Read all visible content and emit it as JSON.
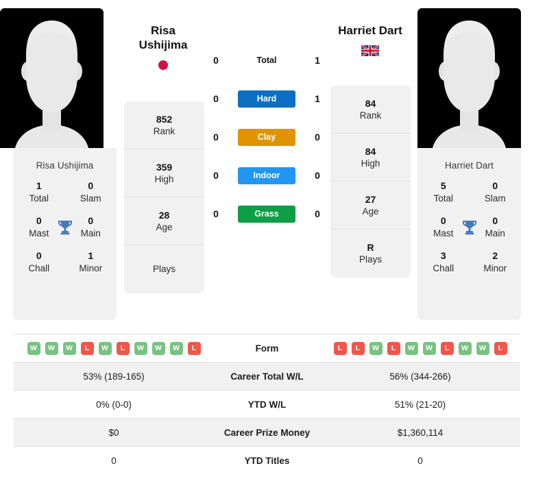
{
  "players": {
    "left": {
      "first_name": "Risa",
      "last_name": "Ushijima",
      "full_name": "Risa Ushijima",
      "flag_icon": "flag-japan-icon",
      "stats": [
        {
          "value": "852",
          "label": "Rank"
        },
        {
          "value": "359",
          "label": "High"
        },
        {
          "value": "28",
          "label": "Age"
        },
        {
          "value": "",
          "label": "Plays"
        }
      ],
      "titles": [
        {
          "value": "1",
          "label": "Total"
        },
        {
          "value": "0",
          "label": "Slam"
        },
        {
          "value": "0",
          "label": "Mast"
        },
        {
          "value": "0",
          "label": "Main"
        },
        {
          "value": "0",
          "label": "Chall"
        },
        {
          "value": "1",
          "label": "Minor"
        }
      ],
      "form": [
        "W",
        "W",
        "W",
        "L",
        "W",
        "L",
        "W",
        "W",
        "W",
        "L"
      ],
      "career_total_wl": "53% (189-165)",
      "ytd_wl": "0% (0-0)",
      "career_prize_money": "$0",
      "ytd_titles": "0"
    },
    "right": {
      "first_name": "Harriet",
      "last_name": "Dart",
      "full_name": "Harriet Dart",
      "flag_icon": "flag-united-kingdom-icon",
      "stats": [
        {
          "value": "84",
          "label": "Rank"
        },
        {
          "value": "84",
          "label": "High"
        },
        {
          "value": "27",
          "label": "Age"
        },
        {
          "value": "R",
          "label": "Plays"
        }
      ],
      "titles": [
        {
          "value": "5",
          "label": "Total"
        },
        {
          "value": "0",
          "label": "Slam"
        },
        {
          "value": "0",
          "label": "Mast"
        },
        {
          "value": "0",
          "label": "Main"
        },
        {
          "value": "3",
          "label": "Chall"
        },
        {
          "value": "2",
          "label": "Minor"
        }
      ],
      "form": [
        "L",
        "L",
        "W",
        "L",
        "W",
        "W",
        "L",
        "W",
        "W",
        "L"
      ],
      "career_total_wl": "56% (344-266)",
      "ytd_wl": "51% (21-20)",
      "career_prize_money": "$1,360,114",
      "ytd_titles": "0"
    }
  },
  "head_to_head": [
    {
      "label": "Total",
      "left": "0",
      "right": "1",
      "badge": false,
      "color": ""
    },
    {
      "label": "Hard",
      "left": "0",
      "right": "1",
      "badge": true,
      "color": "#0c6fc4"
    },
    {
      "label": "Clay",
      "left": "0",
      "right": "0",
      "badge": true,
      "color": "#e09400"
    },
    {
      "label": "Indoor",
      "left": "0",
      "right": "0",
      "badge": true,
      "color": "#2196f3"
    },
    {
      "label": "Grass",
      "left": "0",
      "right": "0",
      "badge": true,
      "color": "#0f9d45"
    }
  ],
  "comparison_rows": [
    {
      "label": "Form",
      "type": "form"
    },
    {
      "label": "Career Total W/L",
      "type": "text",
      "key": "career_total_wl"
    },
    {
      "label": "YTD W/L",
      "type": "text",
      "key": "ytd_wl"
    },
    {
      "label": "Career Prize Money",
      "type": "text",
      "key": "career_prize_money"
    },
    {
      "label": "YTD Titles",
      "type": "text",
      "key": "ytd_titles"
    }
  ],
  "colors": {
    "card_bg": "#f1f1f1",
    "win": "#78c283",
    "loss": "#f0564a",
    "trophy": "#4a7ab5",
    "japan_red": "#d3104a"
  },
  "icons": {
    "avatar": "player-avatar-placeholder-icon",
    "trophy": "trophy-icon"
  }
}
